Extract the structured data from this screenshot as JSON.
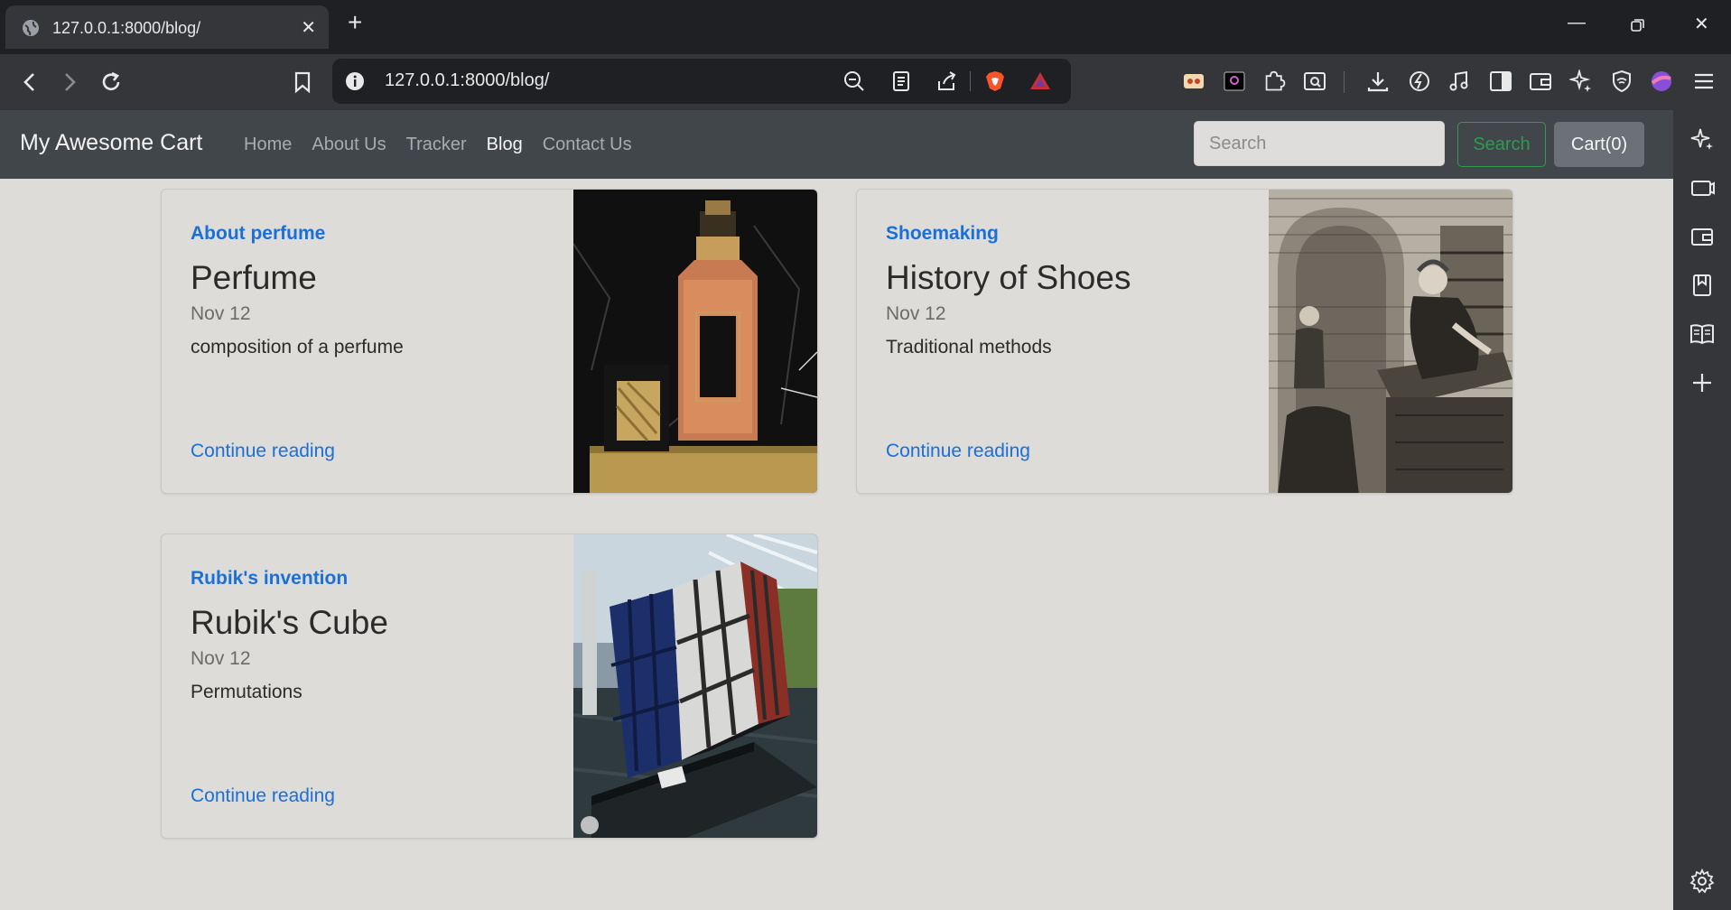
{
  "browser": {
    "tab_title": "127.0.0.1:8000/blog/",
    "url": "127.0.0.1:8000/blog/"
  },
  "site": {
    "brand": "My Awesome Cart",
    "nav": [
      "Home",
      "About Us",
      "Tracker",
      "Blog",
      "Contact Us"
    ],
    "active_nav": "Blog",
    "search_placeholder": "Search",
    "search_button": "Search",
    "cart_button": "Cart(0)"
  },
  "posts": [
    {
      "category": "About perfume",
      "title": "Perfume",
      "date": "Nov 12",
      "description": "composition of a perfume",
      "link": "Continue reading",
      "image": "perfume-bottle-image"
    },
    {
      "category": "Shoemaking",
      "title": "History of Shoes",
      "date": "Nov 12",
      "description": "Traditional methods",
      "link": "Continue reading",
      "image": "shoemaker-engraving-image"
    },
    {
      "category": "Rubik's invention",
      "title": "Rubik's Cube",
      "date": "Nov 12",
      "description": "Permutations",
      "link": "Continue reading",
      "image": "rubiks-cube-sculpture-image"
    }
  ],
  "colors": {
    "page_bg": "#dddcd9",
    "navbar_bg": "#41464b",
    "link_blue": "#1a6fd8",
    "success_green": "#2e9b4e"
  }
}
